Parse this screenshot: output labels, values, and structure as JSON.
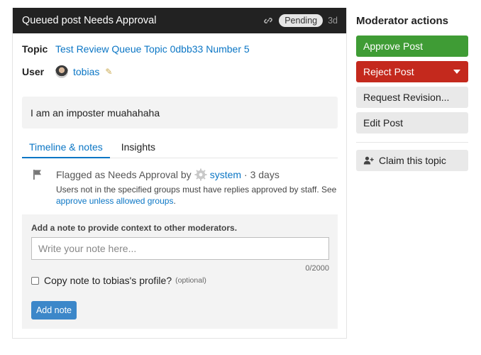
{
  "card": {
    "title": "Queued post Needs Approval",
    "status": "Pending",
    "age": "3d"
  },
  "meta": {
    "topic_label": "Topic",
    "topic_value": "Test Review Queue Topic 0dbb33 Number 5",
    "user_label": "User",
    "user_value": "tobias"
  },
  "post": {
    "body": "I am an imposter muahahaha"
  },
  "tabs": [
    {
      "label": "Timeline & notes"
    },
    {
      "label": "Insights"
    }
  ],
  "timeline": {
    "event_text": "Flagged as Needs Approval by",
    "actor": "system",
    "when": "· 3 days",
    "desc_text": "Users not in the specified groups must have replies approved by staff. See",
    "desc_link": "approve unless allowed groups",
    "desc_end": "."
  },
  "note": {
    "label": "Add a note to provide context to other moderators.",
    "placeholder": "Write your note here...",
    "counter": "0/2000",
    "copy_label": "Copy note to tobias's profile?",
    "optional": "(optional)",
    "add_button": "Add note"
  },
  "sidebar": {
    "title": "Moderator actions",
    "approve": "Approve Post",
    "reject": "Reject Post",
    "request_revision": "Request Revision...",
    "edit": "Edit Post",
    "claim": "Claim this topic"
  },
  "colors": {
    "header_bg": "#222222",
    "link": "#0b76c5",
    "approve": "#3f9c35",
    "reject": "#c4291d",
    "primary": "#3c87c9"
  }
}
